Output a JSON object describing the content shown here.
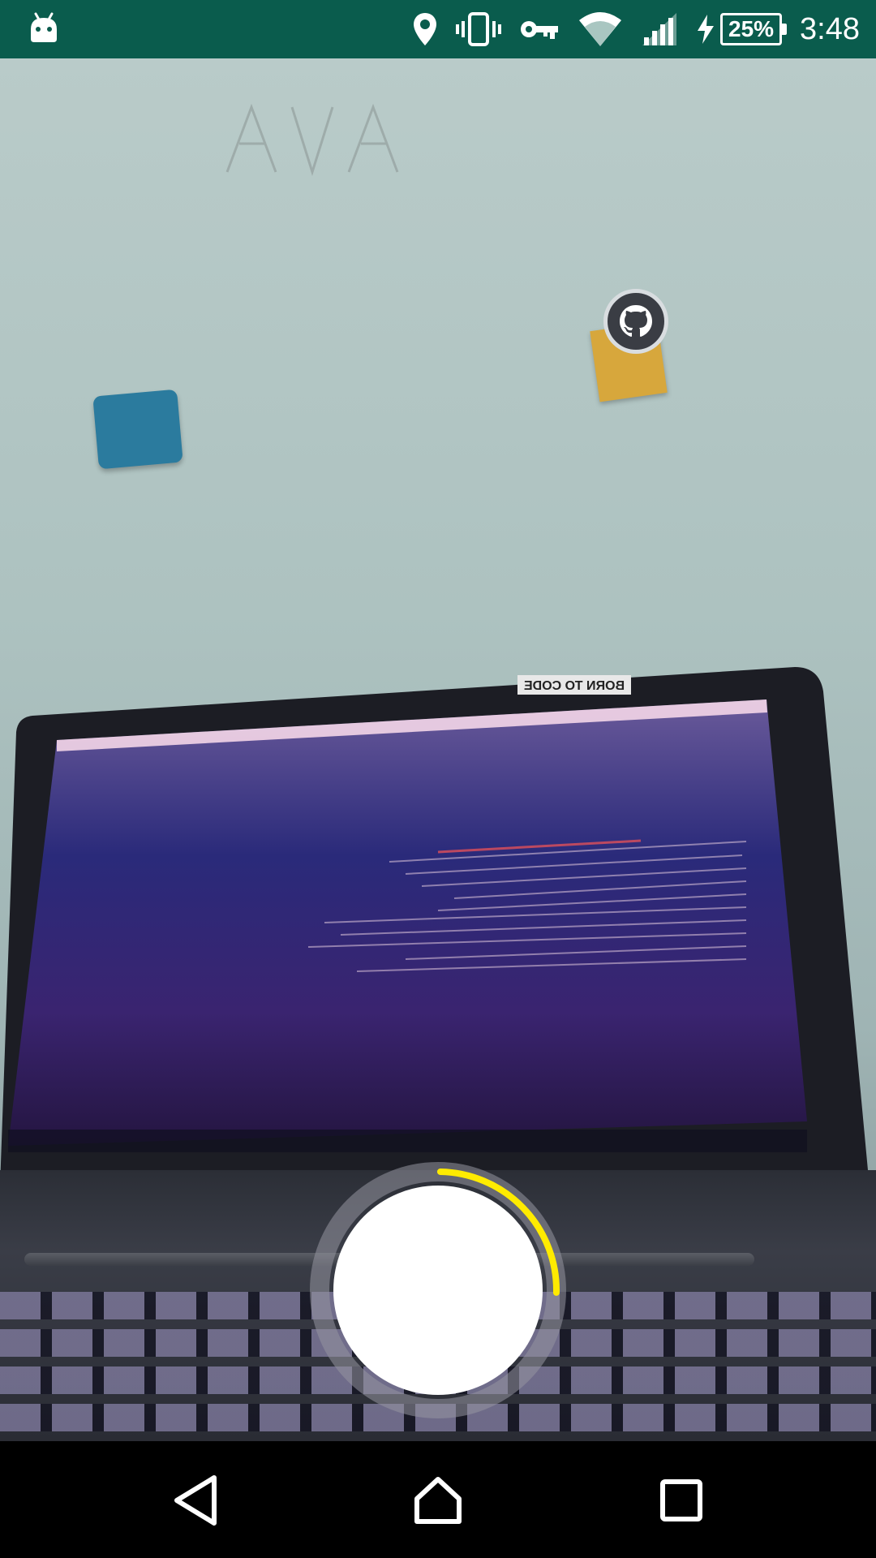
{
  "status_bar": {
    "battery_percent": "25%",
    "time": "3:48",
    "background_color": "#0a5c4d",
    "icons": [
      "android-icon",
      "location-icon",
      "vibrate-icon",
      "vpn-key-icon",
      "wifi-icon",
      "cell-signal-icon",
      "charging-bolt-icon",
      "battery-icon"
    ]
  },
  "camera": {
    "capture_progress_color": "#ffeb00",
    "capture_progress_fraction": 0.25,
    "laptop_sticker_text": "BORN TO CODE"
  },
  "nav_bar": {
    "buttons": [
      "back",
      "home",
      "recents"
    ]
  }
}
